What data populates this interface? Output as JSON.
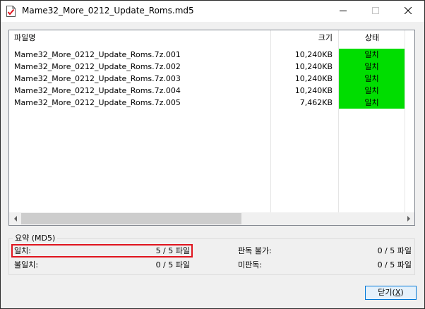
{
  "window": {
    "title": "Mame32_More_0212_Update_Roms.md5"
  },
  "list": {
    "columns": {
      "name": "파일명",
      "size": "크기",
      "status": "상태"
    },
    "rows": [
      {
        "name": "Mame32_More_0212_Update_Roms.7z.001",
        "size": "10,240KB",
        "status": "일치"
      },
      {
        "name": "Mame32_More_0212_Update_Roms.7z.002",
        "size": "10,240KB",
        "status": "일치"
      },
      {
        "name": "Mame32_More_0212_Update_Roms.7z.003",
        "size": "10,240KB",
        "status": "일치"
      },
      {
        "name": "Mame32_More_0212_Update_Roms.7z.004",
        "size": "10,240KB",
        "status": "일치"
      },
      {
        "name": "Mame32_More_0212_Update_Roms.7z.005",
        "size": "7,462KB",
        "status": "일치"
      }
    ],
    "status_color": "#00dd00"
  },
  "summary": {
    "title": "요약 (MD5)",
    "match_label": "일치:",
    "match_value": "5 / 5 파일",
    "mismatch_label": "불일치:",
    "mismatch_value": "0 / 5 파일",
    "undeterminable_label": "판독 불가:",
    "undeterminable_value": "0 / 5 파일",
    "unchecked_label": "미판독:",
    "unchecked_value": "0 / 5 파일",
    "highlight_color": "#e0141e"
  },
  "buttons": {
    "close_label": "닫기(",
    "close_mnemonic": "X",
    "close_suffix": ")"
  },
  "icons": {
    "app": "document-check-icon",
    "minimize": "minimize-icon",
    "maximize": "maximize-icon",
    "close": "close-icon"
  }
}
